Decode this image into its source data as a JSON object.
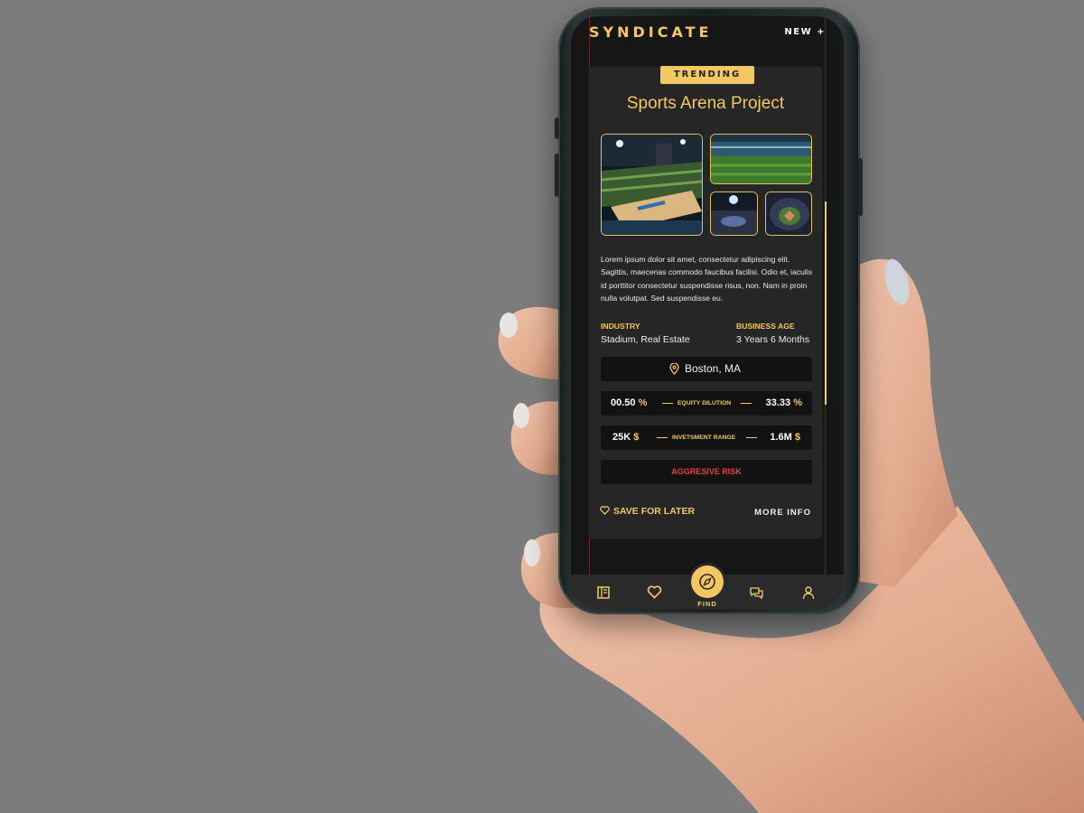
{
  "app": {
    "brand": "SYNDICATE",
    "new_label": "NEW +"
  },
  "card": {
    "badge": "TRENDING",
    "title": "Sports Arena Project",
    "description": "Lorem ipsum dolor sit amet, consectetur adipiscing elit. Sagittis, maecenas commodo faucibus facilisi. Odio et, iaculis id porttitor consectetur suspendisse risus, non. Nam in proin nulla volutpat. Sed suspendisse eu.",
    "industry_label": "INDUSTRY",
    "industry_value": "Stadium, Real Estate",
    "age_label": "BUSINESS AGE",
    "age_value": "3 Years 6 Months",
    "location": "Boston, MA",
    "equity": {
      "min": "00.50",
      "unit": "%",
      "label": "EQUITY DILUTION",
      "max": "33.33",
      "max_unit": "%"
    },
    "investment": {
      "min": "25K",
      "unit": "$",
      "label": "INVETSMENT RANGE",
      "max": "1.6M",
      "max_unit": "$"
    },
    "risk": "AGGRESIVE RISK",
    "save_label": "SAVE FOR LATER",
    "more_label": "MORE INFO"
  },
  "nav": {
    "find_label": "FIND",
    "items": [
      "catalog-icon",
      "heart-icon",
      "compass-icon",
      "chat-icon",
      "user-icon"
    ]
  },
  "colors": {
    "accent": "#f4c763",
    "card_bg": "#262626",
    "screen_bg": "#161616",
    "risk": "#e8423e"
  }
}
